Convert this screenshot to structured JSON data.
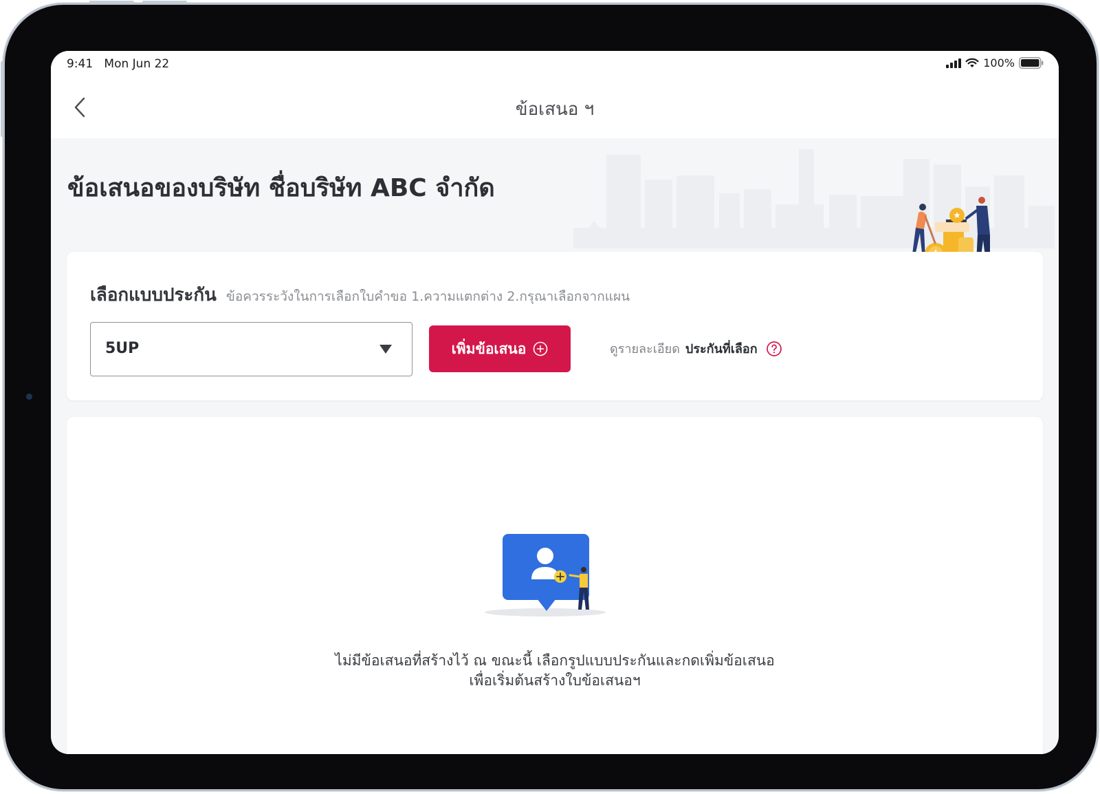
{
  "status_bar": {
    "time": "9:41",
    "date": "Mon Jun 22",
    "battery": "100%"
  },
  "nav": {
    "title": "ข้อเสนอ ฯ"
  },
  "hero": {
    "title": "ข้อเสนอของบริษัท ชื่อบริษัท ABC จำกัด"
  },
  "plan_selection": {
    "label": "เลือกแบบประกัน",
    "hint": "ข้อควรระวังในการเลือกใบคำขอ 1.ความแตกต่าง 2.กรุณาเลือกจากแผน",
    "selected_plan": "5UP",
    "add_button_label": "เพิ่มข้อเสนอ",
    "details_link_label": "ดูรายละเอียด",
    "details_link_strong": "ประกันที่เลือก"
  },
  "empty_state": {
    "line1": "ไม่มีข้อเสนอที่สร้างไว้ ณ ขณะนี้ เลือกรูปแบบประกันและกดเพิ่มข้อเสนอ",
    "line2": "เพื่อเริ่มต้นสร้างใบข้อเสนอฯ"
  },
  "colors": {
    "accent": "#d4174a",
    "background": "#f5f6f8",
    "card": "#ffffff",
    "illustration_blue": "#2f6fe0",
    "coin_gold": "#f5b62a"
  },
  "icons": {
    "back": "chevron-left-icon",
    "dropdown": "caret-down-icon",
    "add": "plus-circle-icon",
    "help": "question-circle-icon",
    "signal": "cellular-signal-icon",
    "wifi": "wifi-icon",
    "battery": "battery-icon"
  }
}
